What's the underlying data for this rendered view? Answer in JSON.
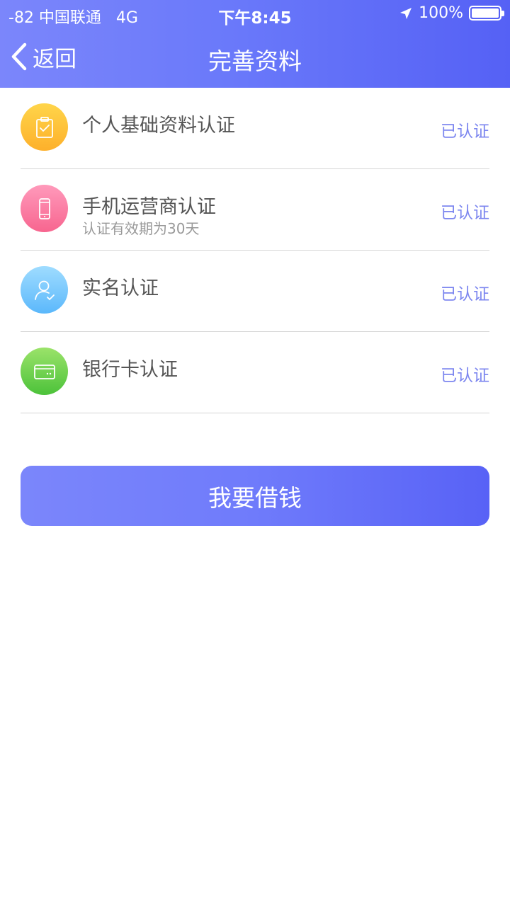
{
  "status_bar": {
    "signal_carrier": "-82 中国联通   4G",
    "time": "下午8:45",
    "battery": "100%"
  },
  "nav": {
    "back_label": "返回",
    "title": "完善资料"
  },
  "items": [
    {
      "title": "个人基础资料认证",
      "subtitle": "",
      "status": "已认证",
      "icon": "clipboard-check-icon",
      "color_from": "#ffd54a",
      "color_to": "#fdb02b"
    },
    {
      "title": "手机运营商认证",
      "subtitle": "认证有效期为30天",
      "status": "已认证",
      "icon": "phone-icon",
      "color_from": "#ff9abb",
      "color_to": "#f7658f"
    },
    {
      "title": "实名认证",
      "subtitle": "",
      "status": "已认证",
      "icon": "user-check-icon",
      "color_from": "#9fdcff",
      "color_to": "#5bb8fb"
    },
    {
      "title": "银行卡认证",
      "subtitle": "",
      "status": "已认证",
      "icon": "bank-card-icon",
      "color_from": "#9be36a",
      "color_to": "#4cc23a"
    }
  ],
  "primary_button": "我要借钱",
  "colors": {
    "accent_from": "#7b86fb",
    "accent_to": "#5561f5",
    "status_text": "#7c86ef"
  }
}
